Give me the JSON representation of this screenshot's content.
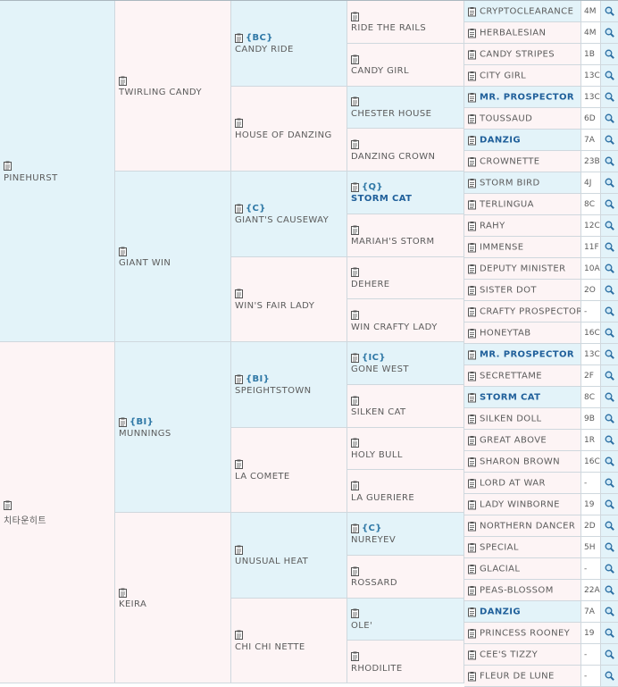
{
  "gen1": [
    {
      "name": "PINEHURST",
      "tag": ""
    },
    {
      "name": "치타운히트",
      "tag": ""
    }
  ],
  "gen2": [
    {
      "name": "TWIRLING CANDY",
      "tag": ""
    },
    {
      "name": "GIANT WIN",
      "tag": ""
    },
    {
      "name": "MUNNINGS",
      "tag": "{BI}"
    },
    {
      "name": "KEIRA",
      "tag": ""
    }
  ],
  "gen3": [
    {
      "name": "CANDY RIDE",
      "tag": "{BC}"
    },
    {
      "name": "HOUSE OF DANZING",
      "tag": ""
    },
    {
      "name": "GIANT'S CAUSEWAY",
      "tag": "{C}"
    },
    {
      "name": "WIN'S FAIR LADY",
      "tag": ""
    },
    {
      "name": "SPEIGHTSTOWN",
      "tag": "{BI}"
    },
    {
      "name": "LA COMETE",
      "tag": ""
    },
    {
      "name": "UNUSUAL HEAT",
      "tag": ""
    },
    {
      "name": "CHI CHI NETTE",
      "tag": ""
    }
  ],
  "gen4": [
    {
      "name": "RIDE THE RAILS",
      "tag": "",
      "bold": false
    },
    {
      "name": "CANDY GIRL",
      "tag": "",
      "bold": false
    },
    {
      "name": "CHESTER HOUSE",
      "tag": "",
      "bold": false
    },
    {
      "name": "DANZING CROWN",
      "tag": "",
      "bold": false
    },
    {
      "name": "STORM CAT",
      "tag": "{Q}",
      "bold": true
    },
    {
      "name": "MARIAH'S STORM",
      "tag": "",
      "bold": false
    },
    {
      "name": "DEHERE",
      "tag": "",
      "bold": false
    },
    {
      "name": "WIN CRAFTY LADY",
      "tag": "",
      "bold": false
    },
    {
      "name": "GONE WEST",
      "tag": "{IC}",
      "bold": false
    },
    {
      "name": "SILKEN CAT",
      "tag": "",
      "bold": false
    },
    {
      "name": "HOLY BULL",
      "tag": "",
      "bold": false
    },
    {
      "name": "LA GUERIERE",
      "tag": "",
      "bold": false
    },
    {
      "name": "NUREYEV",
      "tag": "{C}",
      "bold": false
    },
    {
      "name": "ROSSARD",
      "tag": "",
      "bold": false
    },
    {
      "name": "OLE'",
      "tag": "",
      "bold": false
    },
    {
      "name": "RHODILITE",
      "tag": "",
      "bold": false
    }
  ],
  "gen5": [
    {
      "name": "CRYPTOCLEARANCE",
      "bold": false,
      "code": "4M"
    },
    {
      "name": "HERBALESIAN",
      "bold": false,
      "code": "4M"
    },
    {
      "name": "CANDY STRIPES",
      "bold": false,
      "code": "1B"
    },
    {
      "name": "CITY GIRL",
      "bold": false,
      "code": "13C"
    },
    {
      "name": "MR. PROSPECTOR",
      "bold": true,
      "code": "13C"
    },
    {
      "name": "TOUSSAUD",
      "bold": false,
      "code": "6D"
    },
    {
      "name": "DANZIG",
      "bold": true,
      "code": "7A"
    },
    {
      "name": "CROWNETTE",
      "bold": false,
      "code": "23B"
    },
    {
      "name": "STORM BIRD",
      "bold": false,
      "code": "4J"
    },
    {
      "name": "TERLINGUA",
      "bold": false,
      "code": "8C"
    },
    {
      "name": "RAHY",
      "bold": false,
      "code": "12C"
    },
    {
      "name": "IMMENSE",
      "bold": false,
      "code": "11F"
    },
    {
      "name": "DEPUTY MINISTER",
      "bold": false,
      "code": "10A"
    },
    {
      "name": "SISTER DOT",
      "bold": false,
      "code": "2O"
    },
    {
      "name": "CRAFTY PROSPECTOR",
      "bold": false,
      "code": "-"
    },
    {
      "name": "HONEYTAB",
      "bold": false,
      "code": "16C"
    },
    {
      "name": "MR. PROSPECTOR",
      "bold": true,
      "code": "13C"
    },
    {
      "name": "SECRETTAME",
      "bold": false,
      "code": "2F"
    },
    {
      "name": "STORM CAT",
      "bold": true,
      "code": "8C"
    },
    {
      "name": "SILKEN DOLL",
      "bold": false,
      "code": "9B"
    },
    {
      "name": "GREAT ABOVE",
      "bold": false,
      "code": "1R"
    },
    {
      "name": "SHARON BROWN",
      "bold": false,
      "code": "16C"
    },
    {
      "name": "LORD AT WAR",
      "bold": false,
      "code": "-"
    },
    {
      "name": "LADY WINBORNE",
      "bold": false,
      "code": "19"
    },
    {
      "name": "NORTHERN DANCER",
      "bold": false,
      "code": "2D"
    },
    {
      "name": "SPECIAL",
      "bold": false,
      "code": "5H"
    },
    {
      "name": "GLACIAL",
      "bold": false,
      "code": "-"
    },
    {
      "name": "PEAS-BLOSSOM",
      "bold": false,
      "code": "22A"
    },
    {
      "name": "DANZIG",
      "bold": true,
      "code": "7A"
    },
    {
      "name": "PRINCESS ROONEY",
      "bold": false,
      "code": "19"
    },
    {
      "name": "CEE'S TIZZY",
      "bold": false,
      "code": "-"
    },
    {
      "name": "FLEUR DE LUNE",
      "bold": false,
      "code": "-"
    }
  ],
  "icons": {
    "record": "clipboard-icon",
    "search": "magnifier-icon"
  }
}
